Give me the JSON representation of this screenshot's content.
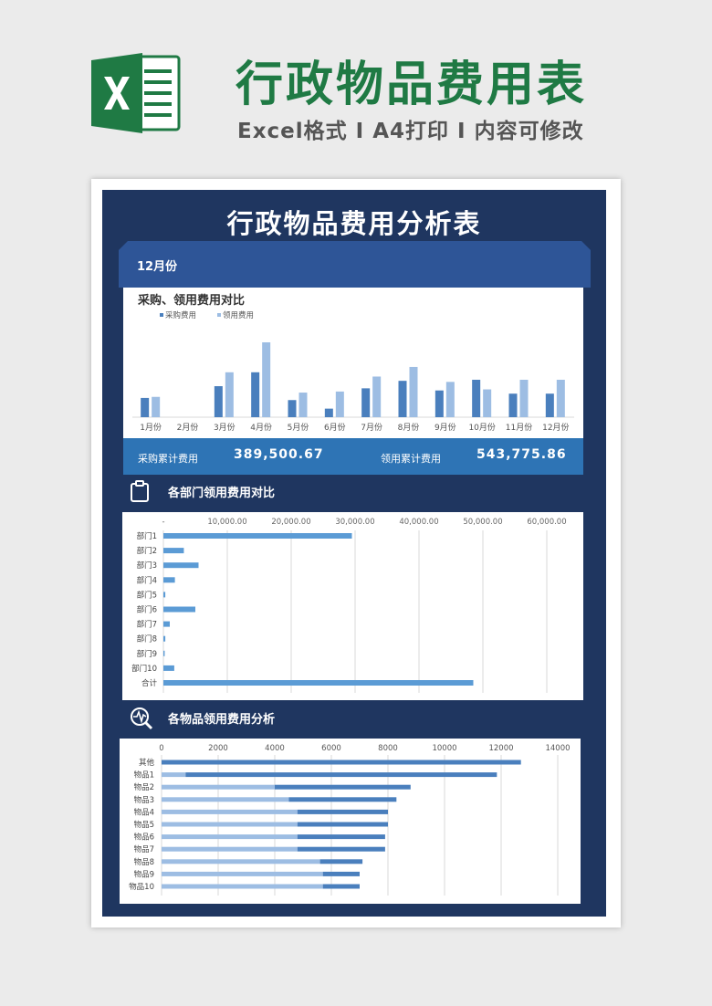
{
  "header": {
    "title": "行政物品费用表",
    "subtitle": "Excel格式 I A4打印 I 内容可修改"
  },
  "sheet": {
    "title": "行政物品费用分析表",
    "month": "12月份"
  },
  "colors": {
    "brand_green": "#1f7a44",
    "navy": "#1f3660",
    "band_blue": "#2e5597",
    "summary_blue": "#2e74b5",
    "series_dark": "#4a7fbd",
    "series_light": "#9dbde3"
  },
  "summary": {
    "purchase_label": "采购累计费用",
    "purchase_value": "389,500.67",
    "use_label": "领用累计费用",
    "use_value": "543,775.86"
  },
  "sections": {
    "dept_title": "各部门领用费用对比",
    "dept_icon": "clipboard-icon",
    "items_title": "各物品领用费用分析",
    "items_icon": "search-pulse-icon"
  },
  "chart_data": [
    {
      "type": "bar",
      "title": "采购、领用费用对比",
      "categories": [
        "1月份",
        "2月份",
        "3月份",
        "4月份",
        "5月份",
        "6月份",
        "7月份",
        "8月份",
        "9月份",
        "10月份",
        "11月份",
        "12月份"
      ],
      "series": [
        {
          "name": "采购费用",
          "values": [
            18,
            0,
            29,
            42,
            16,
            8,
            27,
            34,
            25,
            35,
            22,
            22
          ]
        },
        {
          "name": "领用费用",
          "values": [
            19,
            0,
            42,
            70,
            23,
            24,
            38,
            47,
            33,
            26,
            35,
            35
          ]
        }
      ],
      "legend": "top-left",
      "grid": false
    },
    {
      "type": "bar",
      "orientation": "horizontal",
      "title": "各部门领用费用对比",
      "categories": [
        "部门1",
        "部门2",
        "部门3",
        "部门4",
        "部门5",
        "部门6",
        "部门7",
        "部门8",
        "部门9",
        "部门10",
        "合计"
      ],
      "values": [
        29500,
        3200,
        5500,
        1800,
        300,
        5000,
        1000,
        300,
        200,
        1700,
        48500
      ],
      "xticks": [
        "-",
        "10,000.00",
        "20,000.00",
        "30,000.00",
        "40,000.00",
        "50,000.00",
        "60,000.00"
      ],
      "xlim": [
        0,
        60000
      ],
      "grid": true
    },
    {
      "type": "bar",
      "orientation": "horizontal",
      "stacked": true,
      "title": "各物品领用费用分析",
      "categories": [
        "其他",
        "物品1",
        "物品2",
        "物品3",
        "物品4",
        "物品5",
        "物品6",
        "物品7",
        "物品8",
        "物品9",
        "物品10"
      ],
      "series": [
        {
          "values": [
            0,
            850,
            4000,
            4500,
            4800,
            4800,
            4800,
            4800,
            5600,
            5700,
            5700
          ]
        },
        {
          "values": [
            12700,
            11000,
            4800,
            3800,
            3200,
            3200,
            3100,
            3100,
            1500,
            1300,
            1300
          ]
        }
      ],
      "xticks": [
        "0",
        "2000",
        "4000",
        "6000",
        "8000",
        "10000",
        "12000",
        "14000"
      ],
      "xlim": [
        0,
        14000
      ],
      "grid": true
    }
  ]
}
